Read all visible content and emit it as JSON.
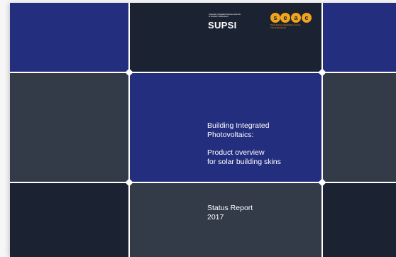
{
  "cover": {
    "logo_supsi": {
      "small_text_1": "University of Applied Sciences and Arts",
      "small_text_2": "of Southern Switzerland",
      "wordmark": "SUPSI"
    },
    "logo_seac": {
      "letters": [
        "s",
        "e",
        "a",
        "c"
      ],
      "sub_line_1": "Solar Energy Application Centre",
      "sub_line_2": "The Netherlands"
    },
    "title_lines": [
      "Building Integrated",
      "Photovoltaics:"
    ],
    "subtitle_lines": [
      "Product overview",
      "for solar building skins"
    ],
    "status_lines": [
      "Status Report",
      "2017"
    ]
  },
  "colors": {
    "blue": "#232e7e",
    "navy": "#1b2232",
    "slate": "#333b49",
    "accent_orange": "#f2a51b"
  }
}
